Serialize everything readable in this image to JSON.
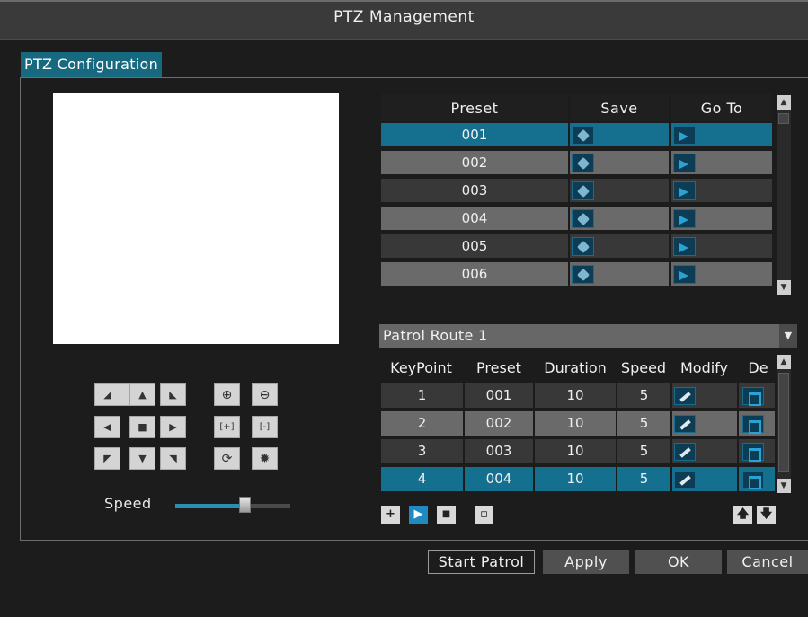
{
  "window": {
    "title": "PTZ Management"
  },
  "tab": {
    "label": "PTZ Configuration"
  },
  "ptz_pad": {
    "direction_icons": [
      "up-left-arrow-icon",
      "up-arrow-icon",
      "up-right-arrow-icon",
      "left-arrow-icon",
      "stop-icon",
      "right-arrow-icon",
      "down-left-arrow-icon",
      "down-arrow-icon",
      "down-right-arrow-icon"
    ],
    "lens_icons": [
      "zoom-in-icon",
      "zoom-out-icon",
      "focus-near-icon",
      "focus-far-icon",
      "iris-open-icon",
      "iris-close-icon"
    ]
  },
  "speed": {
    "label": "Speed",
    "value_fraction": 0.6
  },
  "preset_table": {
    "headers": [
      "Preset",
      "Save",
      "Go To"
    ],
    "rows": [
      "001",
      "002",
      "003",
      "004",
      "005",
      "006"
    ],
    "selected_index": 0
  },
  "patrol": {
    "selected_route": "Patrol Route 1",
    "headers": [
      "KeyPoint",
      "Preset",
      "Duration",
      "Speed",
      "Modify",
      "De"
    ],
    "rows": [
      {
        "keypoint": "1",
        "preset": "001",
        "duration": "10",
        "speed": "5"
      },
      {
        "keypoint": "2",
        "preset": "002",
        "duration": "10",
        "speed": "5"
      },
      {
        "keypoint": "3",
        "preset": "003",
        "duration": "10",
        "speed": "5"
      },
      {
        "keypoint": "4",
        "preset": "004",
        "duration": "10",
        "speed": "5"
      }
    ],
    "selected_index": 3
  },
  "footer": {
    "start_patrol": "Start Patrol",
    "apply": "Apply",
    "ok": "OK",
    "cancel": "Cancel"
  },
  "colors": {
    "accent": "#15708f",
    "background": "#1c1c1c"
  }
}
